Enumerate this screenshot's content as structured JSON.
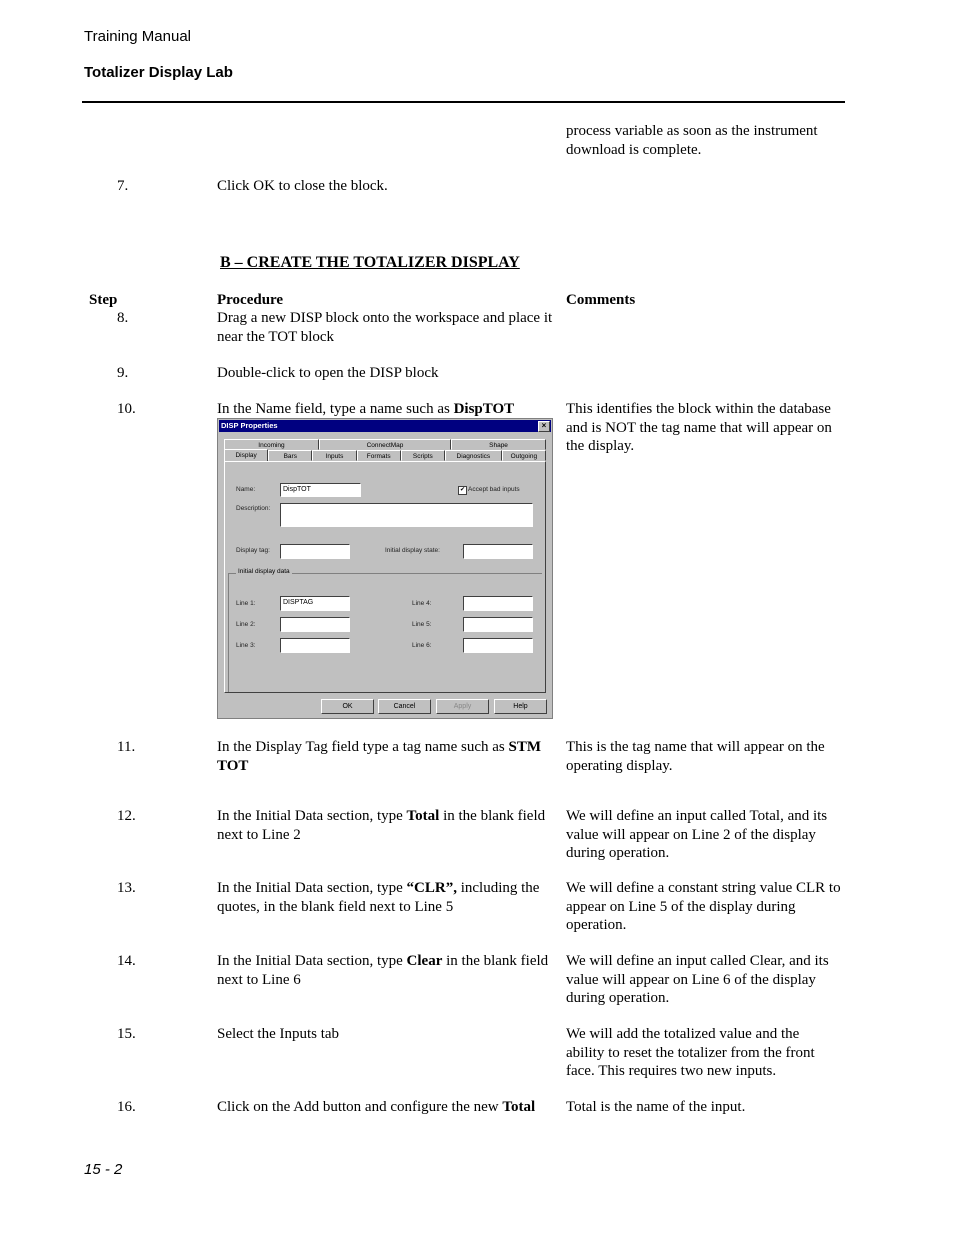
{
  "header": {
    "manual": "Training Manual",
    "section": "Totalizer Display Lab"
  },
  "carry_over": {
    "comment": "process variable as soon as the instrument download is complete."
  },
  "step7": {
    "num": "7.",
    "procedure": "Click OK to close the block."
  },
  "section_heading": "B – CREATE THE TOTALIZER DISPLAY",
  "columns": {
    "step": "Step",
    "procedure": "Procedure",
    "comments": "Comments"
  },
  "steps": [
    {
      "num": "8.",
      "procedure_parts": [
        "Drag a new DISP block onto the workspace and place it near the TOT block"
      ],
      "comment": ""
    },
    {
      "num": "9.",
      "procedure_parts": [
        "Double-click to open the DISP block"
      ],
      "comment": ""
    },
    {
      "num": "10.",
      "procedure_pre": "In the Name field, type a name such as ",
      "procedure_bold": "DispTOT",
      "procedure_post": "",
      "comment": "This identifies the block within the database and is NOT the tag name that will appear on the display."
    },
    {
      "num": "11.",
      "procedure_pre": "In the Display Tag field type a tag name such as ",
      "procedure_bold": "STM TOT",
      "procedure_post": "",
      "comment": "This is the tag name that will appear on the operating display."
    },
    {
      "num": "12.",
      "procedure_pre": "In the Initial Data section, type ",
      "procedure_bold": "Total",
      "procedure_post": " in the blank field next to Line 2",
      "comment": "We will define an input called Total, and its value will appear on Line 2 of the display during operation."
    },
    {
      "num": "13.",
      "procedure_pre": "In the Initial Data section, type ",
      "procedure_bold": "“CLR”,",
      "procedure_post": " including the quotes, in the blank field next to Line 5",
      "comment": "We will define a constant string value CLR to appear on Line 5 of the display during operation."
    },
    {
      "num": "14.",
      "procedure_pre": "In the Initial Data section, type ",
      "procedure_bold": "Clear",
      "procedure_post": " in the blank field next to Line 6",
      "comment": "We will define an input called Clear, and its value will appear on Line 6 of the display during operation."
    },
    {
      "num": "15.",
      "procedure_parts": [
        "Select the Inputs tab"
      ],
      "comment": "We will add the totalized value and the ability to reset the totalizer from the front face.  This requires two new inputs."
    },
    {
      "num": "16.",
      "procedure_pre": "Click on the Add button and configure the new ",
      "procedure_bold": "Total",
      "procedure_post": "",
      "comment": "Total is the name of the input."
    }
  ],
  "dialog": {
    "title": "DISP Properties",
    "close_icon": "close-icon",
    "tabs_back": [
      "Incoming",
      "ConnectMap",
      "Shape"
    ],
    "tabs_front": [
      "Display",
      "Bars",
      "Inputs",
      "Formats",
      "Scripts",
      "Diagnostics",
      "Outgoing"
    ],
    "active_tab": "Display",
    "name_label": "Name:",
    "name_value": "DispTOT",
    "accept_bad_inputs_label": "Accept bad inputs",
    "accept_bad_inputs_checked": "✔",
    "description_label": "Description:",
    "description_value": "",
    "display_tag_label": "Display tag:",
    "display_tag_value": "",
    "initial_display_state_label": "Initial display state:",
    "initial_display_state_value": "",
    "group_label": "Initial display data",
    "lines": [
      {
        "label": "Line 1:",
        "value": "DISPTAG"
      },
      {
        "label": "Line 2:",
        "value": ""
      },
      {
        "label": "Line 3:",
        "value": ""
      },
      {
        "label": "Line 4:",
        "value": ""
      },
      {
        "label": "Line 5:",
        "value": ""
      },
      {
        "label": "Line 6:",
        "value": ""
      }
    ],
    "buttons": {
      "ok": "OK",
      "cancel": "Cancel",
      "apply": "Apply",
      "help": "Help"
    }
  },
  "footer": {
    "page": "15 - 2"
  }
}
